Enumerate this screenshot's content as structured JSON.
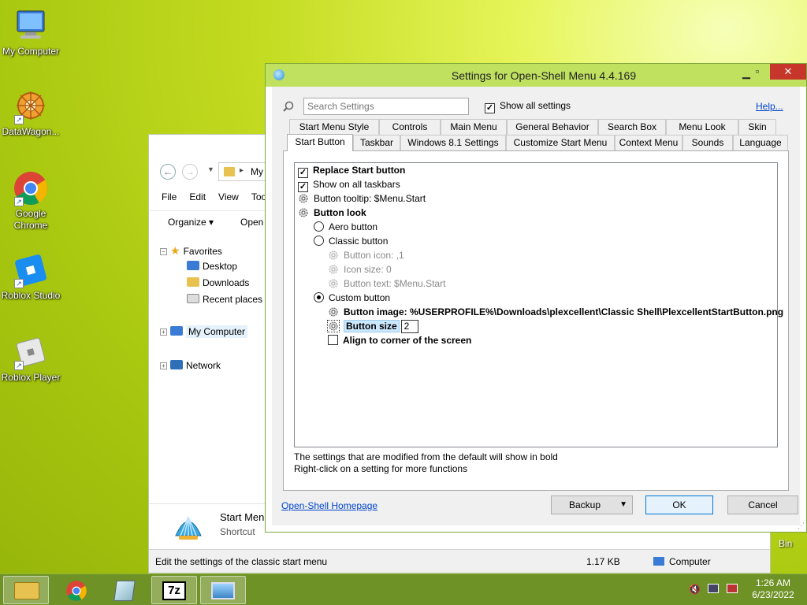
{
  "desktop": {
    "icons": [
      {
        "label": "My Computer",
        "icon": "computer-icon"
      },
      {
        "label": "DataWagon...",
        "icon": "datawagon-icon"
      },
      {
        "label": "Google Chrome",
        "icon": "chrome-icon"
      },
      {
        "label": "Roblox Studio",
        "icon": "roblox-studio-icon"
      },
      {
        "label": "Roblox Player",
        "icon": "roblox-player-icon"
      }
    ],
    "recycle_partial": "Bin"
  },
  "explorer": {
    "address_crumb": "My",
    "menu": [
      "File",
      "Edit",
      "View",
      "Too"
    ],
    "toolbar": {
      "organize": "Organize",
      "open": "Open"
    },
    "tree": {
      "favorites": "Favorites",
      "desktop": "Desktop",
      "downloads": "Downloads",
      "recent": "Recent places",
      "my_computer": "My Computer",
      "network": "Network"
    },
    "details": {
      "name": "Start Menu",
      "type": "Shortcut"
    },
    "status": {
      "text": "Edit the settings of the classic start menu",
      "size": "1.17 KB",
      "location": "Computer"
    }
  },
  "dialog": {
    "title": "Settings for Open-Shell Menu 4.4.169",
    "search_placeholder": "Search Settings",
    "show_all_label": "Show all settings",
    "help_link": "Help...",
    "tabs_row1": [
      "Start Menu Style",
      "Controls",
      "Main Menu",
      "General Behavior",
      "Search Box",
      "Menu Look",
      "Skin"
    ],
    "tabs_row2": [
      "Start Button",
      "Taskbar",
      "Windows 8.1 Settings",
      "Customize Start Menu",
      "Context Menu",
      "Sounds",
      "Language"
    ],
    "settings": {
      "replace_start": "Replace Start button",
      "show_all_taskbars": "Show on all taskbars",
      "tooltip": "Button tooltip: $Menu.Start",
      "button_look": "Button look",
      "aero": "Aero button",
      "classic": "Classic button",
      "button_icon": "Button icon: ,1",
      "icon_size": "Icon size: 0",
      "button_text": "Button text: $Menu.Start",
      "custom": "Custom button",
      "button_image": "Button image: %USERPROFILE%\\Downloads\\plexcellent\\Classic Shell\\PlexcellentStartButton.png",
      "button_size": "Button size",
      "button_size_value": "2",
      "align_corner": "Align to corner of the screen"
    },
    "hint1": "The settings that are modified from the default will show in bold",
    "hint2": "Right-click on a setting for more functions",
    "homepage_link": "Open-Shell Homepage",
    "buttons": {
      "backup": "Backup",
      "ok": "OK",
      "cancel": "Cancel"
    }
  },
  "taskbar": {
    "items": [
      "file-explorer-icon",
      "chrome-icon",
      "notepad-icon",
      "7zip-icon",
      "picture-icon"
    ],
    "seven_zip_label": "7z",
    "time": "1:26 AM",
    "date": "6/23/2022"
  },
  "colors": {
    "titlebar": "#c0e060",
    "taskbar": "#6f9227",
    "close": "#c7362a",
    "link": "#0044cc"
  }
}
